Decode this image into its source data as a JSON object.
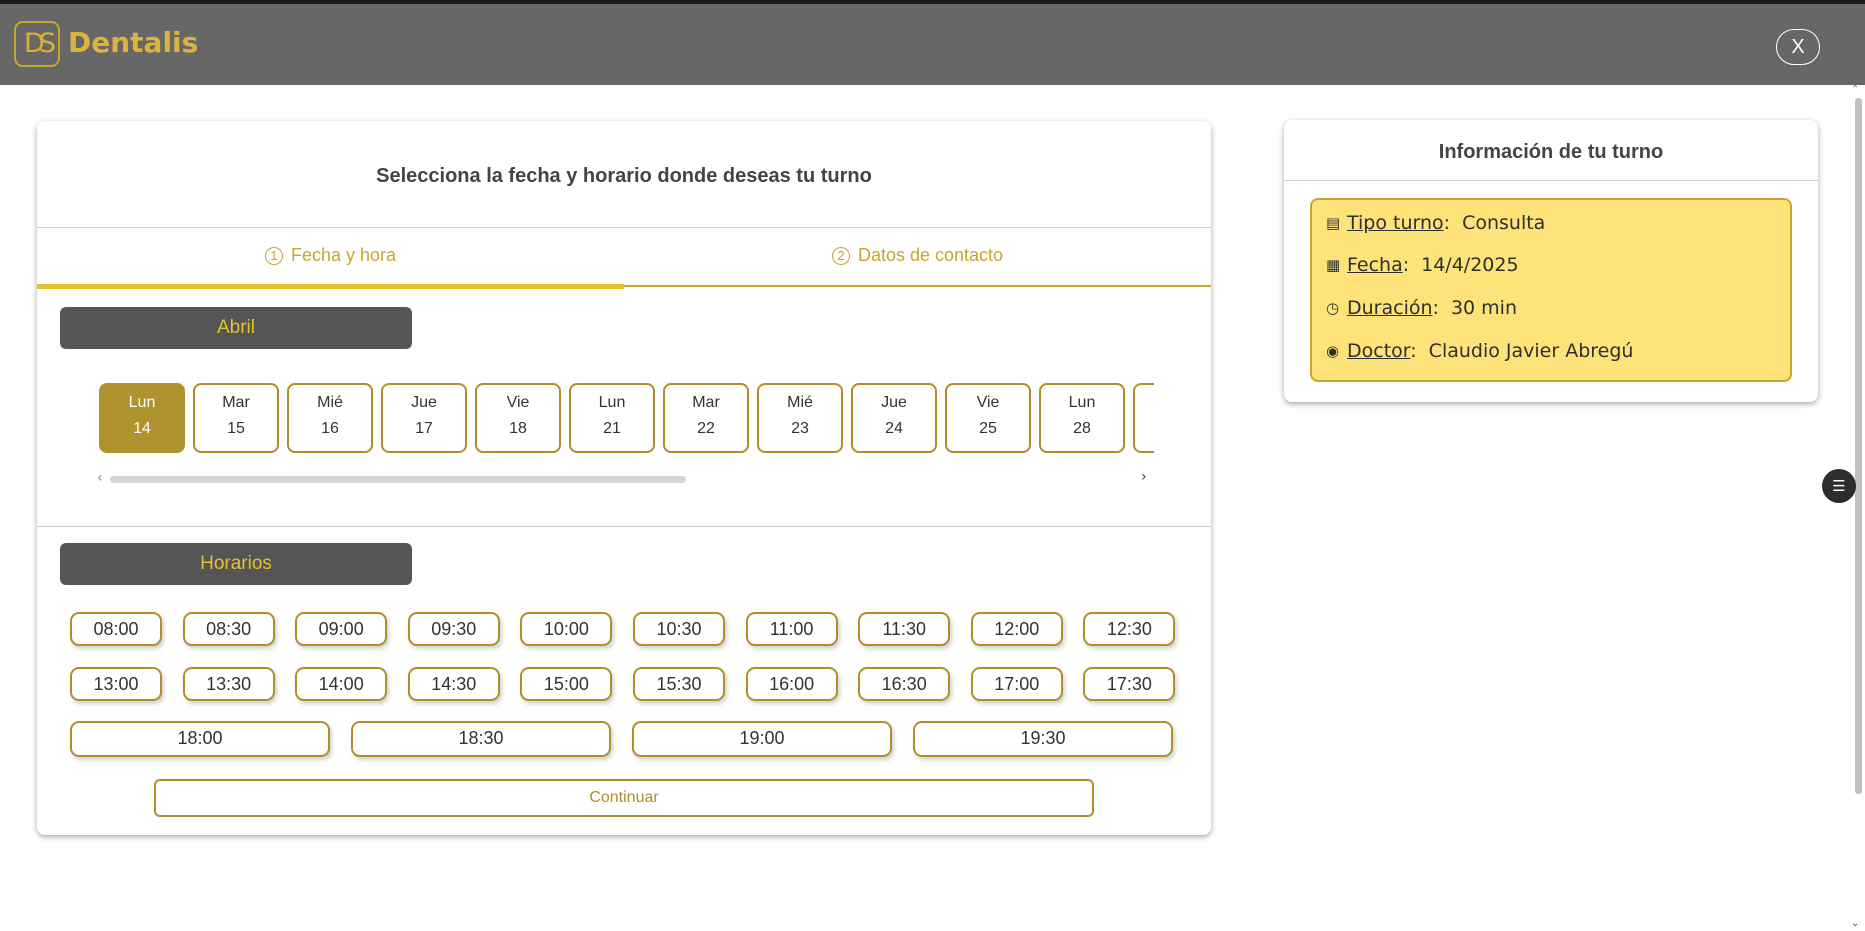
{
  "app": {
    "logo_mark": "DS",
    "name": "Dentalis",
    "close_label": "X"
  },
  "booking": {
    "title": "Selecciona la fecha y horario donde deseas tu turno",
    "tabs": [
      {
        "num": "1",
        "label": "Fecha y hora"
      },
      {
        "num": "2",
        "label": "Datos de contacto"
      }
    ],
    "month_label": "Abril",
    "days": [
      {
        "name": "Lun",
        "date": "14"
      },
      {
        "name": "Mar",
        "date": "15"
      },
      {
        "name": "Mié",
        "date": "16"
      },
      {
        "name": "Jue",
        "date": "17"
      },
      {
        "name": "Vie",
        "date": "18"
      },
      {
        "name": "Lun",
        "date": "21"
      },
      {
        "name": "Mar",
        "date": "22"
      },
      {
        "name": "Mié",
        "date": "23"
      },
      {
        "name": "Jue",
        "date": "24"
      },
      {
        "name": "Vie",
        "date": "25"
      },
      {
        "name": "Lun",
        "date": "28"
      },
      {
        "name": "",
        "date": ""
      }
    ],
    "selected_day_index": 0,
    "scroll_left": "‹",
    "scroll_right": "›",
    "slots_label": "Horarios",
    "slots": [
      "08:00",
      "08:30",
      "09:00",
      "09:30",
      "10:00",
      "10:30",
      "11:00",
      "11:30",
      "12:00",
      "12:30",
      "13:00",
      "13:30",
      "14:00",
      "14:30",
      "15:00",
      "15:30",
      "16:00",
      "16:30",
      "17:00",
      "17:30",
      "18:00",
      "18:30",
      "19:00",
      "19:30"
    ],
    "continue_label": "Continuar"
  },
  "info": {
    "title": "Información de tu turno",
    "rows": [
      {
        "icon": "message-icon",
        "label": "Tipo turno",
        "value": "Consulta"
      },
      {
        "icon": "calendar-icon",
        "label": "Fecha",
        "value": "14/4/2025"
      },
      {
        "icon": "clock-icon",
        "label": "Duración",
        "value": "30 min"
      },
      {
        "icon": "user-circle-icon",
        "label": "Doctor",
        "value": "Claudio Javier Abregú"
      }
    ]
  },
  "colors": {
    "header_bg": "#676767",
    "accent_gold": "#c9a62a",
    "selected_day": "#b0922e",
    "info_box": "#fde37a",
    "section_head": "#555555"
  }
}
